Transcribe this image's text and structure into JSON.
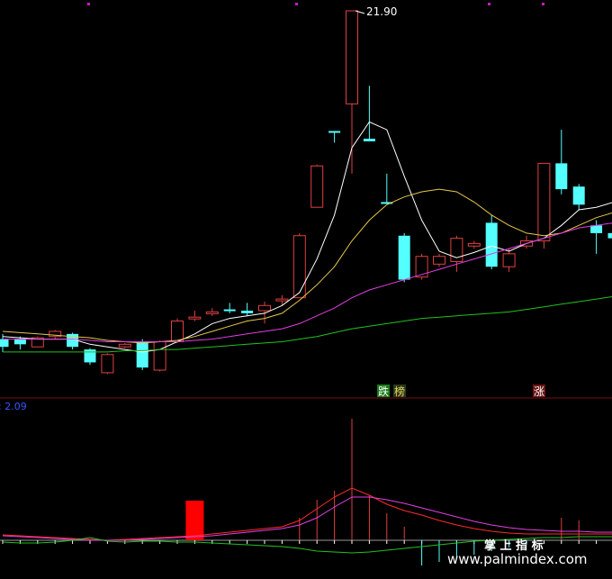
{
  "chart_data": {
    "type": "candlestick",
    "price_panel": {
      "high_label": "21.90",
      "candles": [
        {
          "o": 8.9,
          "c": 9.2,
          "h": 9.4,
          "l": 8.7,
          "up": false
        },
        {
          "o": 9.2,
          "c": 9.0,
          "h": 9.3,
          "l": 8.8,
          "up": false
        },
        {
          "o": 8.9,
          "c": 9.25,
          "h": 9.3,
          "l": 8.9,
          "up": true
        },
        {
          "o": 9.5,
          "c": 9.3,
          "h": 9.55,
          "l": 9.2,
          "up": true
        },
        {
          "o": 9.4,
          "c": 8.9,
          "h": 9.45,
          "l": 8.8,
          "up": false
        },
        {
          "o": 8.8,
          "c": 8.3,
          "h": 8.85,
          "l": 8.2,
          "up": false
        },
        {
          "o": 7.9,
          "c": 8.6,
          "h": 8.65,
          "l": 7.85,
          "up": true
        },
        {
          "o": 8.9,
          "c": 9.0,
          "h": 9.05,
          "l": 8.85,
          "up": true
        },
        {
          "o": 9.1,
          "c": 8.1,
          "h": 9.2,
          "l": 8.0,
          "up": false
        },
        {
          "o": 8.0,
          "c": 9.1,
          "h": 9.15,
          "l": 7.95,
          "up": true
        },
        {
          "o": 9.1,
          "c": 9.9,
          "h": 10.0,
          "l": 9.05,
          "up": true
        },
        {
          "o": 10.0,
          "c": 10.05,
          "h": 10.3,
          "l": 9.9,
          "up": true
        },
        {
          "o": 10.2,
          "c": 10.25,
          "h": 10.4,
          "l": 10.1,
          "up": true
        },
        {
          "o": 10.3,
          "c": 10.35,
          "h": 10.6,
          "l": 10.2,
          "up": false
        },
        {
          "o": 10.3,
          "c": 10.2,
          "h": 10.6,
          "l": 10.1,
          "up": false
        },
        {
          "o": 10.3,
          "c": 10.5,
          "h": 10.65,
          "l": 9.8,
          "up": true
        },
        {
          "o": 10.7,
          "c": 10.75,
          "h": 10.9,
          "l": 10.5,
          "up": true
        },
        {
          "o": 10.8,
          "c": 13.2,
          "h": 13.3,
          "l": 10.8,
          "up": true
        },
        {
          "o": 14.3,
          "c": 15.9,
          "h": 15.95,
          "l": 14.3,
          "up": true
        },
        {
          "o": 17.2,
          "c": 17.25,
          "h": 17.25,
          "l": 16.8,
          "up": false
        },
        {
          "o": 18.3,
          "c": 21.9,
          "h": 21.9,
          "l": 15.6,
          "up": true
        },
        {
          "o": 16.95,
          "c": 16.85,
          "h": 19.0,
          "l": 16.85,
          "up": false
        },
        {
          "o": 14.5,
          "c": 14.45,
          "h": 15.6,
          "l": 14.45,
          "up": false
        },
        {
          "o": 13.2,
          "c": 11.5,
          "h": 13.3,
          "l": 11.4,
          "up": false
        },
        {
          "o": 11.6,
          "c": 12.4,
          "h": 12.5,
          "l": 11.5,
          "up": true
        },
        {
          "o": 12.1,
          "c": 12.4,
          "h": 12.5,
          "l": 12.0,
          "up": true
        },
        {
          "o": 12.2,
          "c": 13.1,
          "h": 13.2,
          "l": 11.8,
          "up": true
        },
        {
          "o": 12.9,
          "c": 12.8,
          "h": 13.0,
          "l": 12.7,
          "up": true
        },
        {
          "o": 13.7,
          "c": 12.0,
          "h": 14.0,
          "l": 11.9,
          "up": false
        },
        {
          "o": 12.0,
          "c": 12.5,
          "h": 12.7,
          "l": 11.8,
          "up": true
        },
        {
          "o": 12.8,
          "c": 13.0,
          "h": 13.2,
          "l": 12.7,
          "up": true
        },
        {
          "o": 13.0,
          "c": 16.0,
          "h": 16.0,
          "l": 12.7,
          "up": true
        },
        {
          "o": 16.0,
          "c": 15.0,
          "h": 17.3,
          "l": 14.8,
          "up": false
        },
        {
          "o": 15.1,
          "c": 14.4,
          "h": 15.2,
          "l": 14.2,
          "up": false
        },
        {
          "o": 13.6,
          "c": 13.3,
          "h": 13.8,
          "l": 12.5,
          "up": false
        },
        {
          "o": 13.3,
          "c": 13.1,
          "h": 13.4,
          "l": 12.7,
          "up": false
        }
      ],
      "moving_averages": [
        {
          "color": "#ffffff",
          "values": [
            9.3,
            9.25,
            9.2,
            9.2,
            9.2,
            9.0,
            8.9,
            8.8,
            8.7,
            8.8,
            9.1,
            9.4,
            9.8,
            10.0,
            10.1,
            10.2,
            10.5,
            11.0,
            12.3,
            14.0,
            16.6,
            17.6,
            17.3,
            15.5,
            13.8,
            12.6,
            12.35,
            12.55,
            12.8,
            12.6,
            12.9,
            13.1,
            13.6,
            14.2,
            14.3,
            14.5
          ]
        },
        {
          "color": "#e6c84a",
          "values": [
            9.5,
            9.45,
            9.4,
            9.35,
            9.3,
            9.25,
            9.15,
            9.1,
            9.05,
            9.1,
            9.15,
            9.3,
            9.5,
            9.7,
            9.9,
            10.0,
            10.2,
            10.7,
            11.3,
            12.0,
            13.0,
            13.8,
            14.4,
            14.7,
            14.9,
            15.0,
            14.9,
            14.5,
            14.0,
            13.6,
            13.3,
            13.2,
            13.3,
            13.6,
            13.9,
            14.1
          ]
        },
        {
          "color": "#e040e0",
          "values": [
            9.2,
            9.2,
            9.2,
            9.2,
            9.2,
            9.15,
            9.1,
            9.1,
            9.1,
            9.1,
            9.1,
            9.15,
            9.2,
            9.3,
            9.4,
            9.5,
            9.6,
            9.8,
            10.1,
            10.4,
            10.8,
            11.1,
            11.3,
            11.5,
            11.7,
            11.9,
            12.1,
            12.3,
            12.5,
            12.7,
            12.9,
            13.1,
            13.3,
            13.5,
            13.6,
            13.7
          ]
        },
        {
          "color": "#22c022",
          "values": [
            8.7,
            8.7,
            8.7,
            8.7,
            8.7,
            8.7,
            8.7,
            8.75,
            8.75,
            8.8,
            8.8,
            8.85,
            8.9,
            8.95,
            9.0,
            9.05,
            9.1,
            9.2,
            9.3,
            9.45,
            9.6,
            9.7,
            9.8,
            9.9,
            10.0,
            10.05,
            10.1,
            10.15,
            10.2,
            10.25,
            10.35,
            10.45,
            10.55,
            10.65,
            10.75,
            10.85
          ]
        }
      ],
      "signals": [
        {
          "label": "跌",
          "bg": "#1a7a1a",
          "color": "#ffffff"
        },
        {
          "label": "榜",
          "bg": "#2a3a1a",
          "color": "#e8d060"
        },
        {
          "label": "涨",
          "bg": "#6a1414",
          "color": "#ffffff"
        }
      ]
    },
    "indicator_panel": {
      "header_fragment": ": 2.09",
      "bars": [
        0,
        0,
        0,
        0,
        0,
        0,
        0,
        0,
        0,
        0,
        0,
        0,
        0,
        0,
        0,
        0,
        0,
        0,
        0,
        0,
        135,
        0,
        0,
        0,
        0,
        0,
        0,
        0,
        0,
        0,
        0,
        0,
        25,
        22,
        0,
        0
      ],
      "lines": [
        {
          "color": "#ff2a2a",
          "values": [
            6,
            5,
            4,
            3,
            2,
            1,
            0,
            1,
            2,
            3,
            4,
            5,
            7,
            9,
            11,
            13,
            15,
            22,
            35,
            48,
            58,
            50,
            40,
            33,
            28,
            22,
            17,
            13,
            10,
            8,
            7,
            7,
            7,
            7,
            7,
            7
          ]
        },
        {
          "color": "#e040e0",
          "values": [
            5,
            4,
            3,
            2,
            1,
            0,
            0,
            0,
            1,
            2,
            3,
            4,
            5,
            7,
            9,
            11,
            13,
            17,
            25,
            37,
            48,
            48,
            45,
            41,
            36,
            31,
            26,
            21,
            17,
            14,
            12,
            11,
            10,
            10,
            9,
            9
          ]
        },
        {
          "color": "#22c022",
          "values": [
            -2,
            -3,
            -3,
            -2,
            0,
            3,
            -1,
            -2,
            -1,
            -1,
            -2,
            -2,
            -3,
            -4,
            -5,
            -6,
            -7,
            -9,
            -12,
            -13,
            -14,
            -13,
            -11,
            -9,
            -7,
            -5,
            -3,
            -1,
            0,
            1,
            2,
            3,
            3,
            4,
            4,
            4
          ]
        }
      ],
      "red_block": 44
    }
  },
  "watermark": {
    "line1": "掌 上 指 标",
    "line2": "www.palmindex.com"
  },
  "colors": {
    "up": "#e04040",
    "down": "#54ffff",
    "separator": "#7a0f0f",
    "marker": "#c020c0"
  }
}
